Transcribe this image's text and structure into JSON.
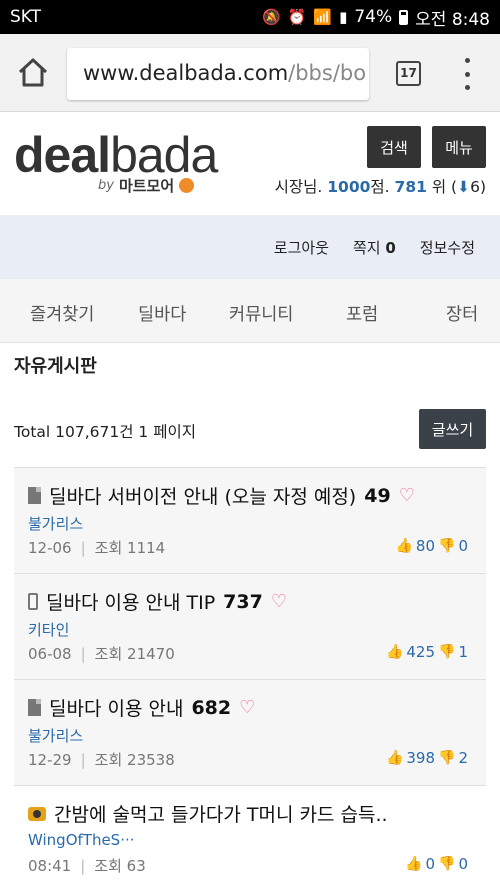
{
  "statusbar": {
    "carrier": "SKT",
    "battery": "74%",
    "time": "오전 8:48"
  },
  "browser": {
    "url_host": "www.dealbada.com",
    "url_path": "/bbs/bo",
    "tab_count": "17"
  },
  "header": {
    "logo_part1": "deal",
    "logo_part2": "bada",
    "by": "by",
    "partner": "마트모어",
    "search_label": "검색",
    "menu_label": "메뉴",
    "user_prefix": "시장님.",
    "points": "1000",
    "points_suffix": "점.",
    "rank": "781",
    "rank_suffix": "위 (",
    "rank_change": "6",
    "rank_close": ")"
  },
  "account": {
    "logout": "로그아웃",
    "messages_label": "쪽지",
    "messages_count": "0",
    "edit_info": "정보수정"
  },
  "nav": {
    "items": [
      "즐겨찾기",
      "딜바다",
      "커뮤니티",
      "포럼",
      "장터"
    ]
  },
  "board": {
    "title": "자유게시판",
    "total": "Total 107,671건 1 페이지",
    "write_label": "글쓰기"
  },
  "posts": [
    {
      "icon": "document-icon",
      "title": "딜바다 서버이전 안내 (오늘 자정 예정)",
      "comments": "49",
      "author": "불가리스",
      "date": "12-06",
      "views": "조회 1114",
      "likes": "80",
      "dislikes": "0"
    },
    {
      "icon": "phone-icon",
      "title": "딜바다 이용 안내 TIP",
      "comments": "737",
      "author": "키타인",
      "date": "06-08",
      "views": "조회 21470",
      "likes": "425",
      "dislikes": "1"
    },
    {
      "icon": "document-icon",
      "title": "딜바다 이용 안내",
      "comments": "682",
      "author": "불가리스",
      "date": "12-29",
      "views": "조회 23538",
      "likes": "398",
      "dislikes": "2"
    },
    {
      "icon": "camera-icon",
      "title": "간밤에 술먹고 들가다가 T머니 카드 습득..",
      "comments": "",
      "author": "WingOfTheS···",
      "date": "08:41",
      "views": "조회 63",
      "likes": "0",
      "dislikes": "0"
    }
  ],
  "colors": {
    "accent_blue": "#2a6aa8",
    "heart_pink": "#f06d9a",
    "account_bg": "#e9edf5"
  }
}
